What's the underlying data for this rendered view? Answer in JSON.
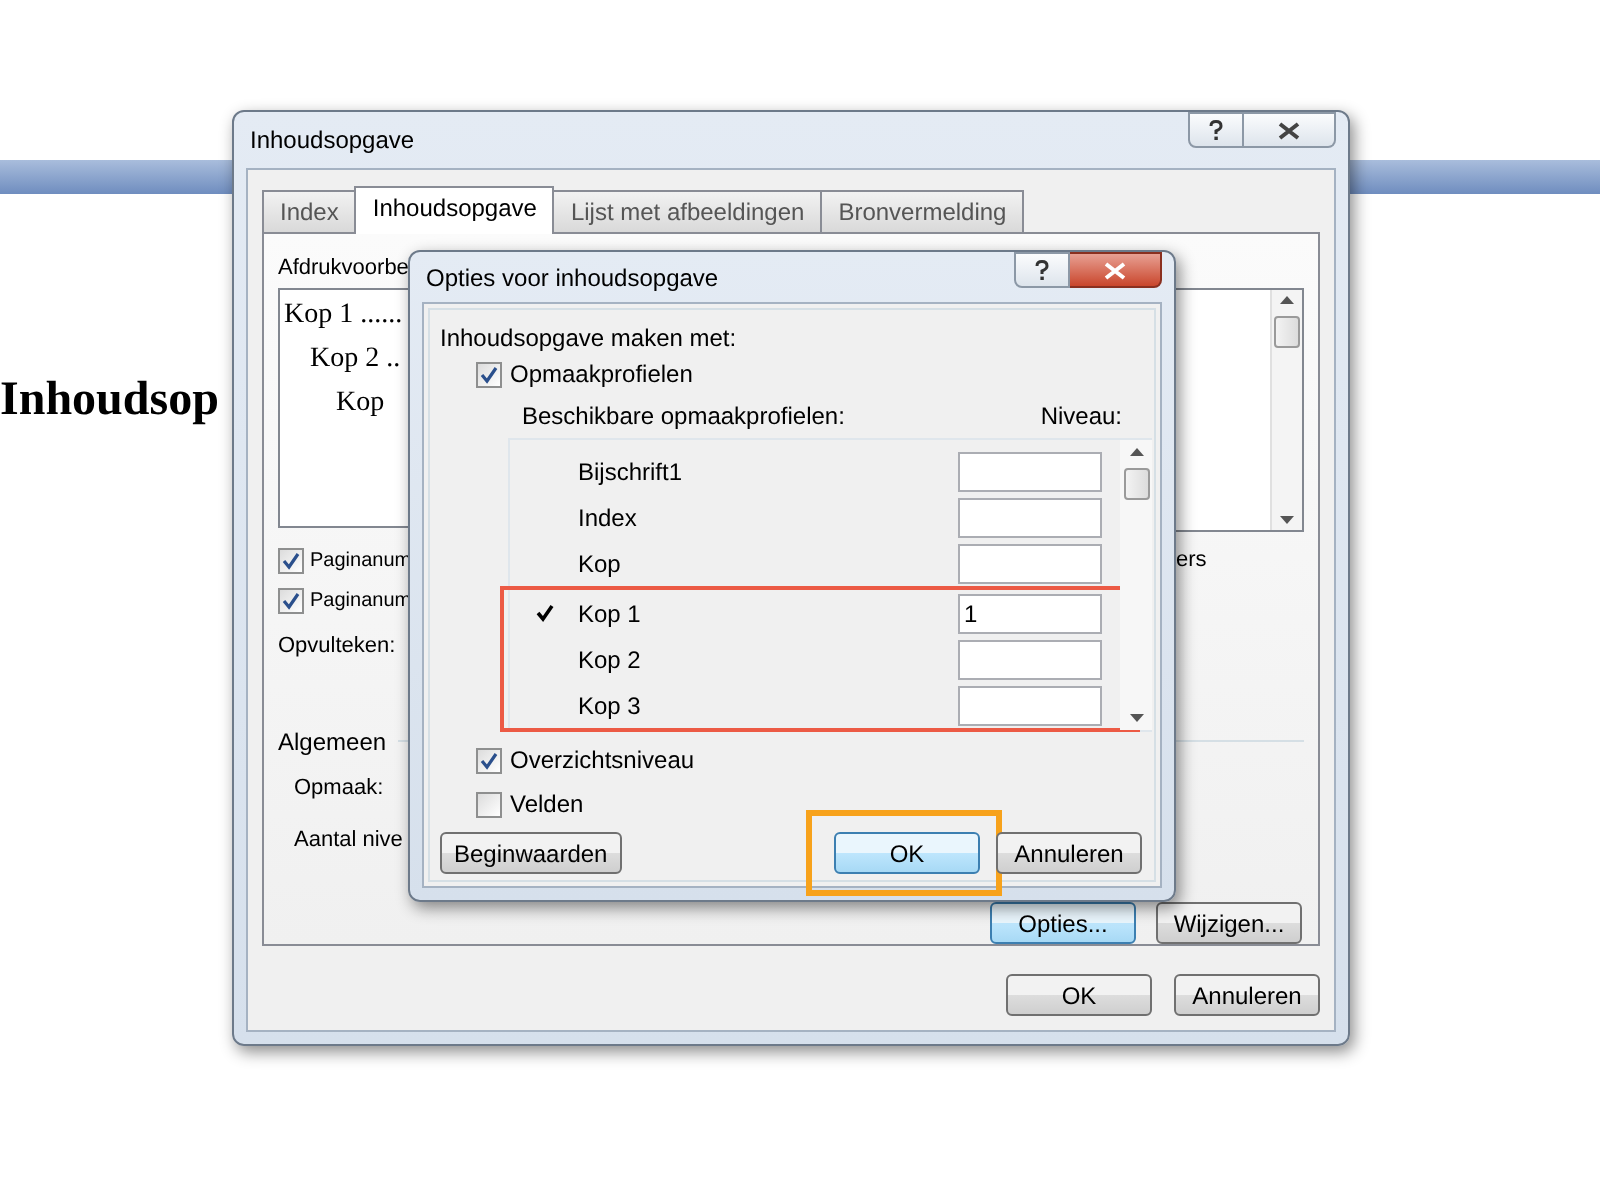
{
  "document": {
    "heading": "Inhoudsop"
  },
  "dialog": {
    "title": "Inhoudsopgave",
    "tabs": [
      {
        "label": "Index",
        "selected": false
      },
      {
        "label": "Inhoudsopgave",
        "selected": true
      },
      {
        "label": "Lijst met afbeeldingen",
        "selected": false
      },
      {
        "label": "Bronvermelding",
        "selected": false
      }
    ],
    "preview_label": "Afdrukvoorbe",
    "preview_lines": [
      "Kop 1 ......",
      "Kop 2 ..",
      "Kop"
    ],
    "checkboxes": [
      {
        "label": "Paginanum",
        "checked": true
      },
      {
        "label": "Paginanum",
        "checked": true
      }
    ],
    "right_text": "ers",
    "fill_label": "Opvulteken:",
    "section": "Algemeen",
    "format_label": "Opmaak:",
    "levels_label": "Aantal nive",
    "buttons": [
      {
        "label": "Opties...",
        "focused": true
      },
      {
        "label": "Wijzigen...",
        "focused": false
      }
    ],
    "footer_buttons": [
      "OK",
      "Annuleren"
    ]
  },
  "options_dialog": {
    "title": "Opties voor inhoudsopgave",
    "build_label": "Inhoudsopgave maken met:",
    "styles_checkbox": {
      "label": "Opmaakprofielen",
      "checked": true
    },
    "styles_header": "Beschikbare opmaakprofielen:",
    "level_header": "Niveau:",
    "styles": [
      {
        "name": "Bijschrift1",
        "checked": false,
        "highlighted": false
      },
      {
        "name": "Index",
        "checked": false,
        "highlighted": false
      },
      {
        "name": "Kop",
        "checked": false,
        "highlighted": false
      },
      {
        "name": "Kop 1",
        "checked": true,
        "highlighted": true,
        "level_value": "1"
      },
      {
        "name": "Kop 2",
        "checked": false,
        "highlighted": true
      },
      {
        "name": "Kop 3",
        "checked": false,
        "highlighted": true
      }
    ],
    "outline_checkbox": {
      "label": "Overzichtsniveau",
      "checked": true
    },
    "fields_checkbox": {
      "label": "Velden",
      "checked": false
    },
    "reset_button": "Beginwaarden",
    "buttons": [
      {
        "label": "OK",
        "focused": true,
        "highlighted": true
      },
      {
        "label": "Annuleren",
        "focused": false,
        "highlighted": false
      }
    ]
  }
}
